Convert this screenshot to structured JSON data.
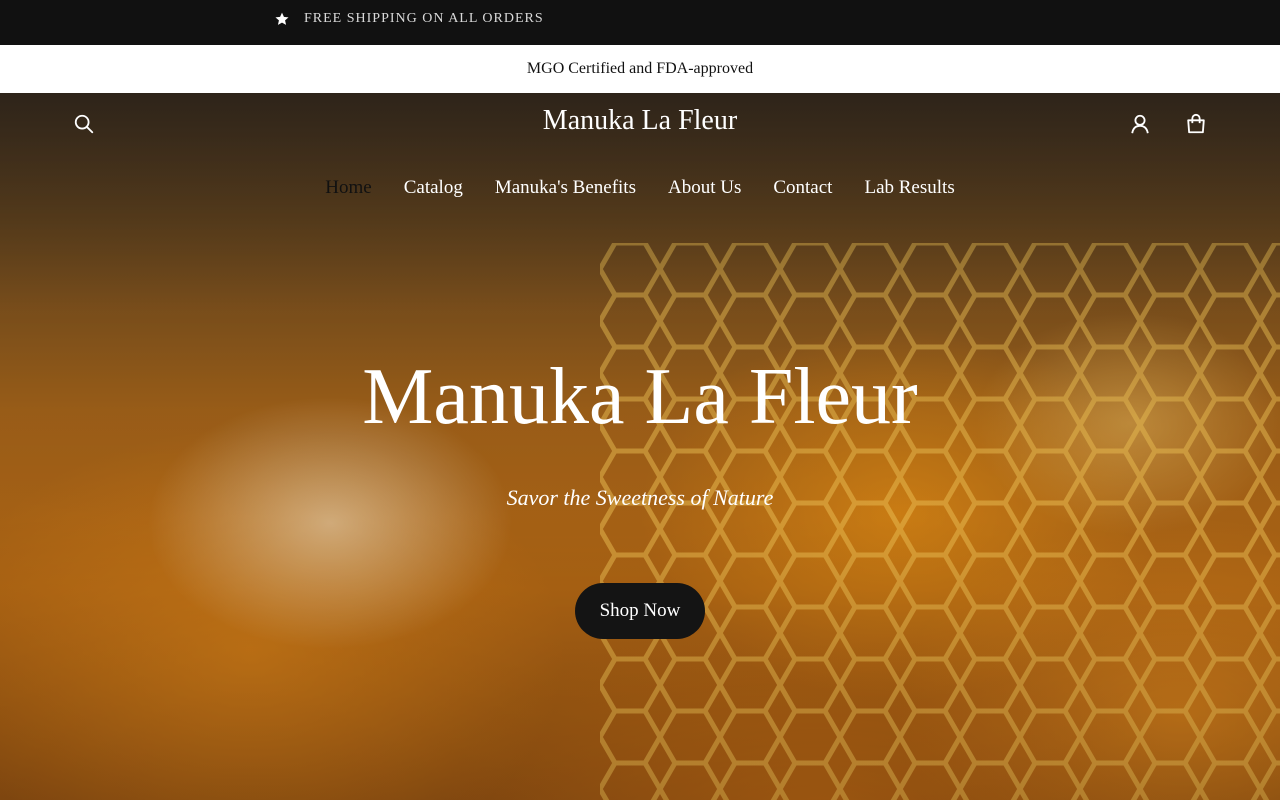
{
  "announcement": {
    "icon": "star-icon",
    "text": "FREE SHIPPING ON ALL ORDERS"
  },
  "subbar": {
    "text": "MGO Certified and FDA-approved"
  },
  "header": {
    "brand": "Manuka La Fleur",
    "search_icon": "search-icon",
    "account_icon": "account-icon",
    "cart_icon": "cart-icon"
  },
  "nav": {
    "items": [
      {
        "label": "Home",
        "active": true
      },
      {
        "label": "Catalog"
      },
      {
        "label": "Manuka's Benefits"
      },
      {
        "label": "About Us"
      },
      {
        "label": "Contact"
      },
      {
        "label": "Lab Results"
      }
    ]
  },
  "hero": {
    "title": "Manuka La Fleur",
    "subtitle": "Savor the Sweetness of Nature",
    "cta_label": "Shop Now",
    "background": "honeycomb-photo"
  },
  "colors": {
    "announcement_bg": "#111111",
    "cta_bg": "#141414",
    "honey": "#b86a14"
  }
}
